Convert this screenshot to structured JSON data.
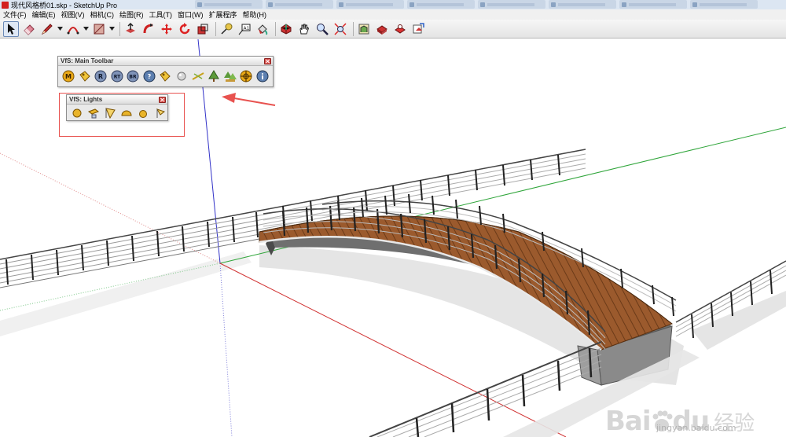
{
  "window": {
    "title": "现代风格桥01.skp - SketchUp Pro"
  },
  "menu": {
    "items": [
      "文件(F)",
      "编辑(E)",
      "视图(V)",
      "相机(C)",
      "绘图(R)",
      "工具(T)",
      "窗口(W)",
      "扩展程序",
      "帮助(H)"
    ]
  },
  "toolbar": {
    "tools": [
      "select-arrow-icon",
      "eraser-icon",
      "pencil-line-icon",
      "arc-icon",
      "rectangle-icon",
      "push-pull-icon",
      "follow-me-icon",
      "move-icon",
      "rotate-icon",
      "scale-icon",
      "tape-measure-icon",
      "text-label-icon",
      "paint-bucket-icon",
      "orbit-icon",
      "pan-hand-icon",
      "zoom-icon",
      "zoom-extents-icon",
      "warehouse-icon",
      "extension-warehouse-icon",
      "layout-icon",
      "send-to-layout-icon"
    ],
    "active_tool": "select-arrow-icon"
  },
  "vfs_main_toolbar": {
    "title": "VfS: Main Toolbar",
    "buttons": [
      {
        "icon": "vfs-material-icon",
        "label": "M"
      },
      {
        "icon": "vfs-tag-icon",
        "label": ""
      },
      {
        "icon": "vfs-render-icon",
        "label": "R"
      },
      {
        "icon": "vfs-rt-icon",
        "label": "RT"
      },
      {
        "icon": "vfs-br-icon",
        "label": "BR"
      },
      {
        "icon": "vfs-help-icon",
        "label": "?"
      },
      {
        "icon": "vfs-tag-2-icon",
        "label": ""
      },
      {
        "icon": "vfs-sphere-icon",
        "label": ""
      },
      {
        "icon": "vfs-sun-icon",
        "label": ""
      },
      {
        "icon": "vfs-tree-icon",
        "label": ""
      },
      {
        "icon": "vfs-tree-2-icon",
        "label": ""
      },
      {
        "icon": "vfs-target-icon",
        "label": ""
      },
      {
        "icon": "vfs-info-icon",
        "label": ""
      }
    ]
  },
  "vfs_lights": {
    "title": "VfS: Lights",
    "buttons": [
      "omni-light-icon",
      "rect-light-icon",
      "spot-light-icon",
      "dome-light-icon",
      "sphere-light-icon",
      "ies-light-icon"
    ]
  },
  "colors": {
    "axis_red": "#d13434",
    "axis_green": "#2fa53a",
    "axis_blue": "#3232c8",
    "deck": "#9b5a2d",
    "annotation": "#e8524f"
  },
  "watermark": {
    "brand": "Bai",
    "brand_tail": "du",
    "cn": "经验",
    "url": "jingyan.baidu.com"
  }
}
